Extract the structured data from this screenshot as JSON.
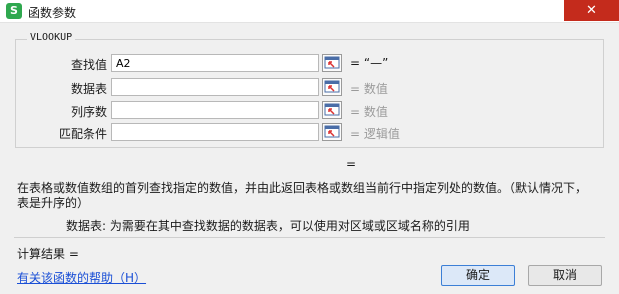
{
  "window": {
    "app_icon_letter": "S",
    "title": "函数参数",
    "close_glyph": "✕"
  },
  "group": {
    "title": "VLOOKUP"
  },
  "args": [
    {
      "label": "查找值",
      "value": "A2",
      "result": "= “—”"
    },
    {
      "label": "数据表",
      "value": "",
      "result": "= 数值"
    },
    {
      "label": "列序数",
      "value": "",
      "result": "= 数值"
    },
    {
      "label": "匹配条件",
      "value": "",
      "result": "= 逻辑值"
    }
  ],
  "function_result_eq": "=",
  "description": {
    "line1": "在表格或数值数组的首列查找指定的数值，并由此返回表格或数组当前行中指定列处的数值。（默认情况下，",
    "line2": "表是升序的）"
  },
  "param_desc": "数据表:  为需要在其中查找数据的数据表，可以使用对区域或区域名称的引用",
  "calc_result": "计算结果  =",
  "help_link": "有关该函数的帮助（H）",
  "buttons": {
    "ok": "确定",
    "cancel": "取消"
  },
  "icons": {
    "app": "spreadsheet-app-icon",
    "ref": "range-select-icon"
  },
  "colors": {
    "close": "#c42b1c",
    "link": "#1a4fd6",
    "app_icon": "#2fa84f"
  }
}
